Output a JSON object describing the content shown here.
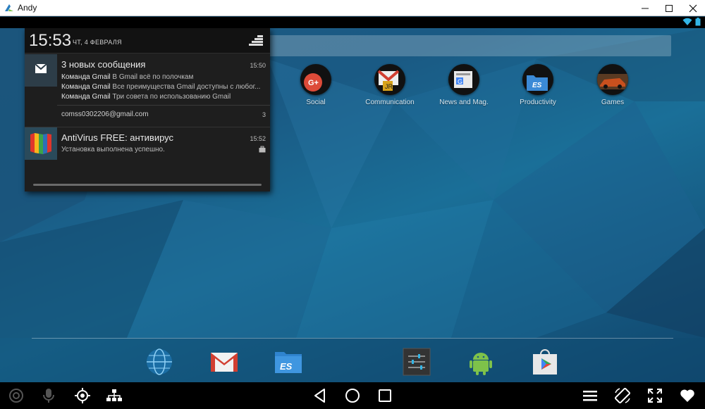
{
  "window": {
    "title": "Andy",
    "controls": [
      "minimize",
      "maximize",
      "close"
    ]
  },
  "colors": {
    "screen_bg": "#1a5a84",
    "accent_red_gmail": "#d23f31",
    "android_green": "#7ec24a"
  },
  "status_bar": {
    "icons": [
      "wifi-icon",
      "battery-icon"
    ]
  },
  "notification_shade": {
    "time": "15:53",
    "date": "ЧТ, 4 ФЕВРАЛЯ",
    "notifications": [
      {
        "app": "gmail",
        "title": "3 новых сообщения",
        "time": "15:50",
        "lines": [
          {
            "sender": "Команда Gmail",
            "text": "В Gmail всё по полочкам"
          },
          {
            "sender": "Команда Gmail",
            "text": "Все преимущества Gmail доступны с любог..."
          },
          {
            "sender": "Команда Gmail",
            "text": "Три совета по использованию Gmail"
          }
        ],
        "account": "comss0302206@gmail.com",
        "count": "3"
      },
      {
        "app": "antivirus",
        "title": "AntiVirus FREE: антивирус",
        "time": "15:52",
        "text": "Установка выполнена успешно."
      }
    ]
  },
  "home": {
    "folders": [
      {
        "label": "Social"
      },
      {
        "label": "Communication"
      },
      {
        "label": "News and Mag."
      },
      {
        "label": "Productivity"
      },
      {
        "label": "Games"
      }
    ],
    "dock": [
      "browser-globe",
      "gmail",
      "es-file-explorer",
      "settings",
      "android",
      "play-store"
    ]
  },
  "toolbar": {
    "left": [
      "camera-icon",
      "microphone-icon",
      "location-target-icon",
      "network-icon"
    ],
    "center": [
      "back-icon",
      "home-icon",
      "recents-icon"
    ],
    "right": [
      "menu-icon",
      "rotate-icon",
      "fullscreen-icon",
      "heart-icon"
    ]
  }
}
